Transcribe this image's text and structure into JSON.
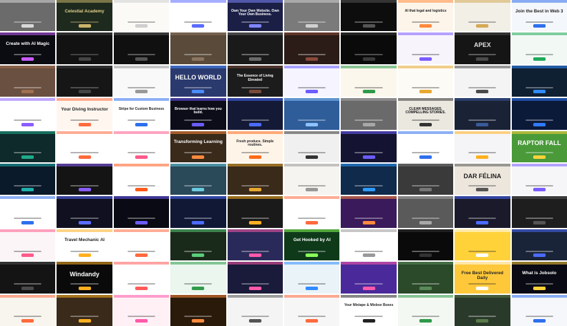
{
  "grid": {
    "cols": 10,
    "rows": 10
  },
  "tiles": [
    {
      "bg": "#6b6b6b",
      "fg": "#ffffff",
      "accent": "#d8d8d8",
      "text": ""
    },
    {
      "bg": "#1e2a1e",
      "fg": "#e4d28a",
      "accent": "#c9b46a",
      "text": "Celestial Academy"
    },
    {
      "bg": "#fbfaf6",
      "fg": "#333333",
      "accent": "#cfcfcf",
      "text": ""
    },
    {
      "bg": "#ffffff",
      "fg": "#222222",
      "accent": "#5b6cff",
      "text": ""
    },
    {
      "bg": "#1b1f46",
      "fg": "#ffffff",
      "accent": "#7e86ff",
      "text": "Own Your Own Website. Own Your Own Business."
    },
    {
      "bg": "#7a7a7a",
      "fg": "#ffffff",
      "accent": "#d0d0d0",
      "text": ""
    },
    {
      "bg": "#0d0d0d",
      "fg": "#e8e8e8",
      "accent": "#555555",
      "text": ""
    },
    {
      "bg": "#fdf5ea",
      "fg": "#222222",
      "accent": "#ff8a3d",
      "text": "AI that legal and logistics"
    },
    {
      "bg": "#f2efe6",
      "fg": "#333333",
      "accent": "#d4a957",
      "text": ""
    },
    {
      "bg": "#f4f7fb",
      "fg": "#222222",
      "accent": "#2f6fed",
      "text": "Join the Best in Web 3"
    },
    {
      "bg": "#0b0b12",
      "fg": "#ffffff",
      "accent": "#c75cff",
      "text": "Create with AI Magic"
    },
    {
      "bg": "#121212",
      "fg": "#9a9a9a",
      "accent": "#444444",
      "text": ""
    },
    {
      "bg": "#101010",
      "fg": "#e0e0e0",
      "accent": "#555555",
      "text": ""
    },
    {
      "bg": "#5a4a3a",
      "fg": "#ffffff",
      "accent": "#8a7560",
      "text": ""
    },
    {
      "bg": "#1a1a1a",
      "fg": "#ffffff",
      "accent": "#6a6a6a",
      "text": ""
    },
    {
      "bg": "#2b1c18",
      "fg": "#ffffff",
      "accent": "#8a4a3a",
      "text": ""
    },
    {
      "bg": "#0a0a0a",
      "fg": "#cccccc",
      "accent": "#3a3a3a",
      "text": ""
    },
    {
      "bg": "#f7f4fb",
      "fg": "#222222",
      "accent": "#7b5cff",
      "text": ""
    },
    {
      "bg": "#151515",
      "fg": "#e0e0e0",
      "accent": "#4a4a4a",
      "text": "APEX"
    },
    {
      "bg": "#f2f8f4",
      "fg": "#1c3b2a",
      "accent": "#1faa5b",
      "text": ""
    },
    {
      "bg": "#6a5040",
      "fg": "#ffffff",
      "accent": "#a07050",
      "text": ""
    },
    {
      "bg": "#161616",
      "fg": "#bbbbbb",
      "accent": "#444444",
      "text": ""
    },
    {
      "bg": "#f9f9f9",
      "fg": "#222222",
      "accent": "#999999",
      "text": ""
    },
    {
      "bg": "#2b3a6e",
      "fg": "#ffffff",
      "accent": "#4b8dff",
      "text": "HELLO WORLD"
    },
    {
      "bg": "#1c1c1c",
      "fg": "#ffffff",
      "accent": "#7a4a3a",
      "text": "The Essence of Living Elevated"
    },
    {
      "bg": "#f5f4ff",
      "fg": "#222222",
      "accent": "#6b5cff",
      "text": ""
    },
    {
      "bg": "#fbf7ec",
      "fg": "#222222",
      "accent": "#2e9a4a",
      "text": ""
    },
    {
      "bg": "#fdfbf5",
      "fg": "#222222",
      "accent": "#e8a830",
      "text": ""
    },
    {
      "bg": "#f4f4f4",
      "fg": "#222222",
      "accent": "#4a4a4a",
      "text": ""
    },
    {
      "bg": "#102033",
      "fg": "#ffffff",
      "accent": "#2f8bff",
      "text": ""
    },
    {
      "bg": "#ffffff",
      "fg": "#222222",
      "accent": "#8b5cff",
      "text": ""
    },
    {
      "bg": "#fff6ef",
      "fg": "#222222",
      "accent": "#ff6a3d",
      "text": "Your Diving Instructor"
    },
    {
      "bg": "#ffffff",
      "fg": "#222222",
      "accent": "#2f6fed",
      "text": "Stripe for Custom Business"
    },
    {
      "bg": "#0d0d1a",
      "fg": "#ffffff",
      "accent": "#6b5cff",
      "text": "Browser that learns how you build."
    },
    {
      "bg": "#141a36",
      "fg": "#ffffff",
      "accent": "#4b6bff",
      "text": ""
    },
    {
      "bg": "#2e5d9a",
      "fg": "#ffffff",
      "accent": "#8cc3ff",
      "text": ""
    },
    {
      "bg": "#6a6a6a",
      "fg": "#ffffff",
      "accent": "#a8a8a8",
      "text": ""
    },
    {
      "bg": "#ebe8e0",
      "fg": "#111111",
      "accent": "#333333",
      "text": "CLEAR MESSAGES. COMPELLING STORIES."
    },
    {
      "bg": "#1a2236",
      "fg": "#ffffff",
      "accent": "#3a5a9a",
      "text": ""
    },
    {
      "bg": "#0c1a3a",
      "fg": "#ffffff",
      "accent": "#2f7bff",
      "text": ""
    },
    {
      "bg": "#0f2a2a",
      "fg": "#ffffff",
      "accent": "#1faa8a",
      "text": ""
    },
    {
      "bg": "#ffffff",
      "fg": "#222222",
      "accent": "#ff6a3d",
      "text": ""
    },
    {
      "bg": "#ffffff",
      "fg": "#222222",
      "accent": "#ff5a8a",
      "text": ""
    },
    {
      "bg": "#3a2a1a",
      "fg": "#ffffff",
      "accent": "#ff8a3d",
      "text": "Transforming Learning"
    },
    {
      "bg": "#fff4e8",
      "fg": "#222222",
      "accent": "#ff6a1a",
      "text": "Fresh produce. Simple routines."
    },
    {
      "bg": "#f0f0f0",
      "fg": "#222222",
      "accent": "#333333",
      "text": ""
    },
    {
      "bg": "#141432",
      "fg": "#ffffff",
      "accent": "#6b5cff",
      "text": ""
    },
    {
      "bg": "#ffffff",
      "fg": "#222222",
      "accent": "#2f6fed",
      "text": ""
    },
    {
      "bg": "#f5f5f7",
      "fg": "#222222",
      "accent": "#ffb020",
      "text": ""
    },
    {
      "bg": "#4a9a3a",
      "fg": "#ffffff",
      "accent": "#ffd23a",
      "text": "RAPTOR FALL"
    },
    {
      "bg": "#0b1a2a",
      "fg": "#ffffff",
      "accent": "#1fb0aa",
      "text": ""
    },
    {
      "bg": "#141414",
      "fg": "#ffffff",
      "accent": "#8a5cff",
      "text": ""
    },
    {
      "bg": "#ffffff",
      "fg": "#222222",
      "accent": "#ff5a1a",
      "text": ""
    },
    {
      "bg": "#2a4a5a",
      "fg": "#ffffff",
      "accent": "#6acadf",
      "text": ""
    },
    {
      "bg": "#3a2a1a",
      "fg": "#ffffff",
      "accent": "#e8a830",
      "text": ""
    },
    {
      "bg": "#f5f4f0",
      "fg": "#222222",
      "accent": "#999999",
      "text": ""
    },
    {
      "bg": "#0f2a4a",
      "fg": "#ffffff",
      "accent": "#2f9bff",
      "text": ""
    },
    {
      "bg": "#3a3a3a",
      "fg": "#ffffff",
      "accent": "#777777",
      "text": ""
    },
    {
      "bg": "#ece6dc",
      "fg": "#222222",
      "accent": "#555555",
      "text": "DAR FÉLINA"
    },
    {
      "bg": "#f6f6f8",
      "fg": "#222222",
      "accent": "#7b5cff",
      "text": ""
    },
    {
      "bg": "#ffffff",
      "fg": "#222222",
      "accent": "#2f6fed",
      "text": ""
    },
    {
      "bg": "#101020",
      "fg": "#ffffff",
      "accent": "#5b6cff",
      "text": ""
    },
    {
      "bg": "#0a0a14",
      "fg": "#ffffff",
      "accent": "#6b5cff",
      "text": ""
    },
    {
      "bg": "#101836",
      "fg": "#ffffff",
      "accent": "#4b6bff",
      "text": ""
    },
    {
      "bg": "#1a1a1a",
      "fg": "#ffffff",
      "accent": "#ffb020",
      "text": ""
    },
    {
      "bg": "#ffffff",
      "fg": "#222222",
      "accent": "#ff6a3d",
      "text": ""
    },
    {
      "bg": "#3a1a5a",
      "fg": "#ffffff",
      "accent": "#ff8a3d",
      "text": ""
    },
    {
      "bg": "#5a5a5a",
      "fg": "#ffffff",
      "accent": "#a8a8a8",
      "text": ""
    },
    {
      "bg": "#1a1a2a",
      "fg": "#ffffff",
      "accent": "#4b6bff",
      "text": ""
    },
    {
      "bg": "#1e1e1e",
      "fg": "#ffffff",
      "accent": "#555555",
      "text": ""
    },
    {
      "bg": "#fbf5f8",
      "fg": "#222222",
      "accent": "#ff5a8a",
      "text": ""
    },
    {
      "bg": "#ffffff",
      "fg": "#222222",
      "accent": "#ffb020",
      "text": "Travel Mechanic AI"
    },
    {
      "bg": "#ffffff",
      "fg": "#222222",
      "accent": "#ff6a3d",
      "text": ""
    },
    {
      "bg": "#1a2a1a",
      "fg": "#ffffff",
      "accent": "#5acd7a",
      "text": ""
    },
    {
      "bg": "#2a2a5a",
      "fg": "#ffffff",
      "accent": "#ff5aaa",
      "text": ""
    },
    {
      "bg": "#0f3a1a",
      "fg": "#ffffff",
      "accent": "#8aff5a",
      "text": "Get Hooked by AI"
    },
    {
      "bg": "#ffffff",
      "fg": "#222222",
      "accent": "#999999",
      "text": ""
    },
    {
      "bg": "#0a0a0a",
      "fg": "#ffffff",
      "accent": "#333333",
      "text": ""
    },
    {
      "bg": "#ffd23a",
      "fg": "#222222",
      "accent": "#ffffff",
      "text": ""
    },
    {
      "bg": "#1a2438",
      "fg": "#ffffff",
      "accent": "#4b6bff",
      "text": ""
    },
    {
      "bg": "#141414",
      "fg": "#ffffff",
      "accent": "#4a4a4a",
      "text": ""
    },
    {
      "bg": "#0a0a0a",
      "fg": "#ffffff",
      "accent": "#ffb020",
      "text": "Windandy"
    },
    {
      "bg": "#ffffff",
      "fg": "#222222",
      "accent": "#ff5a5a",
      "text": ""
    },
    {
      "bg": "#eaf6ee",
      "fg": "#222222",
      "accent": "#2e9a4a",
      "text": ""
    },
    {
      "bg": "#1a1a3a",
      "fg": "#ffffff",
      "accent": "#ff5aaa",
      "text": ""
    },
    {
      "bg": "#eaf3f8",
      "fg": "#222222",
      "accent": "#2f8bff",
      "text": ""
    },
    {
      "bg": "#4a2a9a",
      "fg": "#ffffff",
      "accent": "#ff5aaa",
      "text": ""
    },
    {
      "bg": "#2a4a2a",
      "fg": "#ffffff",
      "accent": "#5a8a5a",
      "text": ""
    },
    {
      "bg": "#ffc83a",
      "fg": "#222222",
      "accent": "#ffffff",
      "text": "Free Best Delivered Daily"
    },
    {
      "bg": "#0a0a14",
      "fg": "#ffffff",
      "accent": "#ffd23a",
      "text": "What is Jobsolo"
    },
    {
      "bg": "#f8f4ee",
      "fg": "#222222",
      "accent": "#ff6a3d",
      "text": ""
    },
    {
      "bg": "#3a2a1a",
      "fg": "#ffffff",
      "accent": "#ffb020",
      "text": ""
    },
    {
      "bg": "#fff0f6",
      "fg": "#222222",
      "accent": "#ff5aaa",
      "text": ""
    },
    {
      "bg": "#2a1a0a",
      "fg": "#ffffff",
      "accent": "#ff8a3d",
      "text": ""
    },
    {
      "bg": "#f4f4f4",
      "fg": "#222222",
      "accent": "#555555",
      "text": ""
    },
    {
      "bg": "#f6f6f6",
      "fg": "#222222",
      "accent": "#ff6a3d",
      "text": ""
    },
    {
      "bg": "#ffffff",
      "fg": "#222222",
      "accent": "#222222",
      "text": "Your Mixtape & Mixbox Boxes"
    },
    {
      "bg": "#f4f8f2",
      "fg": "#222222",
      "accent": "#2e9a4a",
      "text": ""
    },
    {
      "bg": "#2a3a2a",
      "fg": "#ffffff",
      "accent": "#5a7a4a",
      "text": ""
    },
    {
      "bg": "#f6f7fb",
      "fg": "#222222",
      "accent": "#2f6fed",
      "text": ""
    }
  ]
}
